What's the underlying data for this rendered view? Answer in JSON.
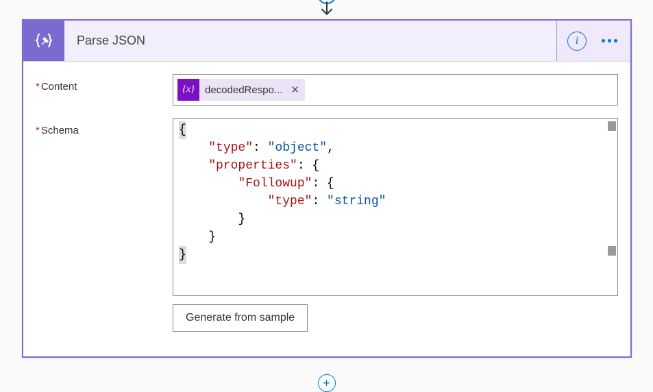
{
  "action": {
    "title": "Parse JSON",
    "icon": "curly-braces-edit-icon"
  },
  "fields": {
    "content": {
      "label": "Content",
      "required": true,
      "token": {
        "label": "decodedRespo...",
        "icon_text": "{x}"
      }
    },
    "schema": {
      "label": "Schema",
      "required": true,
      "code": {
        "line1_brace": "{",
        "line2_key": "\"type\"",
        "line2_val": "\"object\"",
        "line3_key": "\"properties\"",
        "line4_key": "\"Followup\"",
        "line5_key": "\"type\"",
        "line5_val": "\"string\"",
        "line6_brace": "}",
        "line7_brace": "}",
        "line8_brace": "}"
      }
    }
  },
  "buttons": {
    "generate": "Generate from sample",
    "info": "i",
    "add": "+"
  }
}
